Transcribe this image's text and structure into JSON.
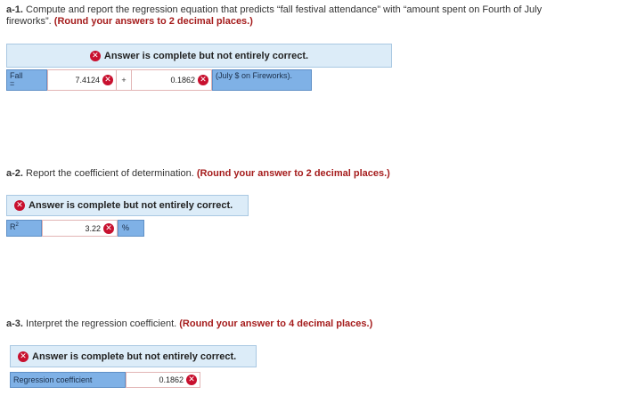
{
  "part_a1": {
    "label": "a-1.",
    "text_line1": " Compute and report the regression equation that predicts “fall festival attendance” with “amount spent on Fourth of July",
    "text_line2": "fireworks”. ",
    "instruction": "(Round your answers to 2 decimal places.)",
    "banner": "Answer is complete but not entirely correct.",
    "lhs": "Fall\n=",
    "intercept": "7.4124",
    "plus": "+",
    "slope": "0.1862",
    "rhs": "(July $ on Fireworks)."
  },
  "part_a2": {
    "label": "a-2.",
    "text": " Report the coefficient of determination. ",
    "instruction": "(Round your answer to 2 decimal places.)",
    "banner": "Answer is complete but not entirely correct.",
    "r_label": "R",
    "r_sup": "2",
    "value": "3.22",
    "unit": "%"
  },
  "part_a3": {
    "label": "a-3.",
    "text": " Interpret the regression coefficient. ",
    "instruction": "(Round your answer to 4 decimal places.)",
    "banner": "Answer is complete but not entirely correct.",
    "row_label": "Regression coefficient",
    "value": "0.1862"
  },
  "icons": {
    "incorrect": "x-circle-icon",
    "incorrect_glyph": "✕"
  },
  "colors": {
    "banner_bg": "#dcecf8",
    "label_cell": "#7fb1e6",
    "error_red": "#c8102e",
    "instruction_red": "#a51c1c"
  }
}
